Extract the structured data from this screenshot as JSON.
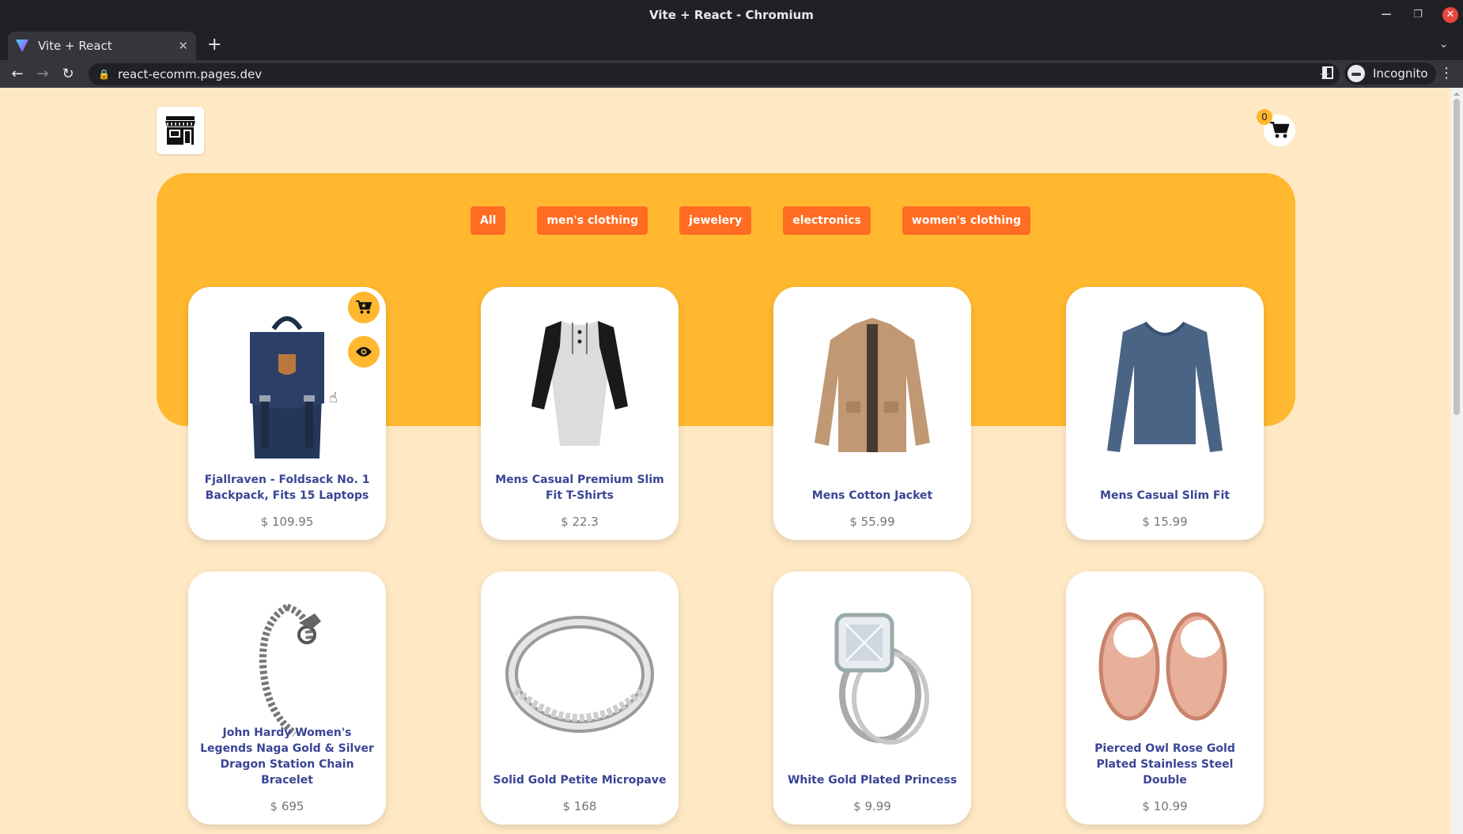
{
  "window": {
    "title": "Vite + React - Chromium"
  },
  "tab": {
    "label": "Vite + React",
    "close": "✕",
    "new_tab": "+",
    "menu": "⌄"
  },
  "toolbar": {
    "url": "react-ecomm.pages.dev",
    "incognito_label": "Incognito"
  },
  "header": {
    "cart_count": "0"
  },
  "filters": [
    "All",
    "men's clothing",
    "jewelery",
    "electronics",
    "women's clothing"
  ],
  "products": [
    {
      "name": "Fjallraven - Foldsack No. 1 Backpack, Fits 15 Laptops",
      "price": "$ 109.95",
      "image_icon": "backpack-image"
    },
    {
      "name": "Mens Casual Premium Slim Fit T-Shirts",
      "price": "$ 22.3",
      "image_icon": "raglan-shirt-image"
    },
    {
      "name": "Mens Cotton Jacket",
      "price": "$ 55.99",
      "image_icon": "jacket-image"
    },
    {
      "name": "Mens Casual Slim Fit",
      "price": "$ 15.99",
      "image_icon": "longsleeve-shirt-image"
    },
    {
      "name": "John Hardy Women's Legends Naga Gold & Silver Dragon Station Chain Bracelet",
      "price": "$ 695",
      "image_icon": "bracelet-image"
    },
    {
      "name": "Solid Gold Petite Micropave",
      "price": "$ 168",
      "image_icon": "ring-image"
    },
    {
      "name": "White Gold Plated Princess",
      "price": "$ 9.99",
      "image_icon": "engagement-ring-image"
    },
    {
      "name": "Pierced Owl Rose Gold Plated Stainless Steel Double",
      "price": "$ 10.99",
      "image_icon": "ear-tunnels-image"
    }
  ],
  "colors": {
    "page_bg": "#ffe9c5",
    "hero_bg": "#ffb82f",
    "filter_bg": "#ff6c22",
    "product_name": "#3a4595"
  }
}
